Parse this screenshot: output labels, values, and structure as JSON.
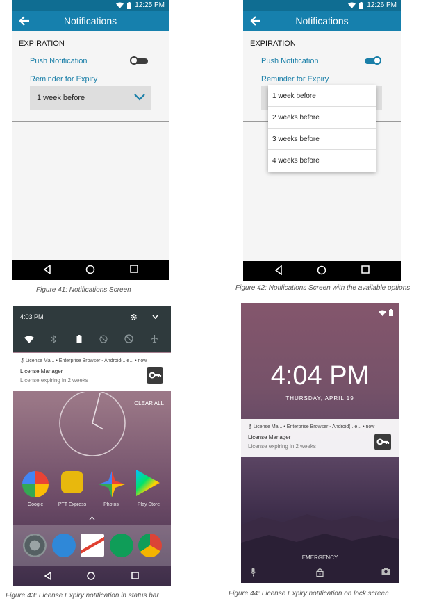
{
  "fig41": {
    "status_time": "12:25 PM",
    "title": "Notifications",
    "section": "EXPIRATION",
    "push_label": "Push Notification",
    "push_on": false,
    "reminder_label": "Reminder for Expiry",
    "reminder_value": "1 week before",
    "caption": "Figure 41: Notifications Screen"
  },
  "fig42": {
    "status_time": "12:26 PM",
    "title": "Notifications",
    "section": "EXPIRATION",
    "push_label": "Push Notification",
    "push_on": true,
    "reminder_label": "Reminder for Expiry",
    "options": [
      "1 week before",
      "2 weeks before",
      "3 weeks before",
      "4 weeks before"
    ],
    "caption": "Figure 42: Notifications Screen with the available options"
  },
  "fig43": {
    "time": "4:03 PM",
    "notif_meta": "License Ma... • Enterprise Browser - Android(...e... • now",
    "notif_title": "License Manager",
    "notif_body": "License expiring in 2 weeks",
    "clear_all": "CLEAR ALL",
    "apps": [
      "Google",
      "PTT Express",
      "Photos",
      "Play Store"
    ],
    "caption": "Figure 43:  License Expiry notification in status bar"
  },
  "fig44": {
    "time": "4:04 PM",
    "date": "THURSDAY, APRIL 19",
    "notif_meta": "License Ma... • Enterprise Browser - Android(...e... • now",
    "notif_title": "License Manager",
    "notif_body": "License expiring in 2 weeks",
    "emergency": "EMERGENCY",
    "caption": "Figure 44:  License Expiry notification on lock screen"
  },
  "colors": {
    "accent": "#1680ad",
    "status": "#0f6d92",
    "link": "#1a7fa8"
  }
}
